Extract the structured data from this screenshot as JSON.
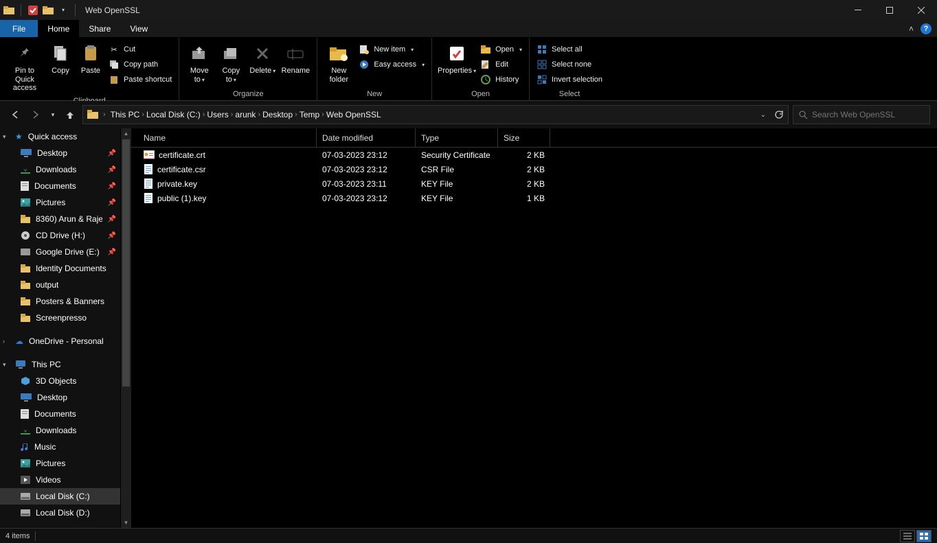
{
  "window": {
    "title": "Web OpenSSL"
  },
  "tabs": {
    "file": "File",
    "home": "Home",
    "share": "Share",
    "view": "View"
  },
  "ribbon": {
    "clipboard": {
      "pin": "Pin to Quick\naccess",
      "copy": "Copy",
      "paste": "Paste",
      "cut": "Cut",
      "copy_path": "Copy path",
      "paste_shortcut": "Paste shortcut",
      "group_label": "Clipboard"
    },
    "organize": {
      "move_to": "Move\nto",
      "copy_to": "Copy\nto",
      "delete": "Delete",
      "rename": "Rename",
      "group_label": "Organize"
    },
    "new": {
      "new_folder": "New\nfolder",
      "new_item": "New item",
      "easy_access": "Easy access",
      "group_label": "New"
    },
    "open": {
      "properties": "Properties",
      "open": "Open",
      "edit": "Edit",
      "history": "History",
      "group_label": "Open"
    },
    "select": {
      "select_all": "Select all",
      "select_none": "Select none",
      "invert": "Invert selection",
      "group_label": "Select"
    }
  },
  "breadcrumb": [
    "This PC",
    "Local Disk (C:)",
    "Users",
    "arunk",
    "Desktop",
    "Temp",
    "Web OpenSSL"
  ],
  "search": {
    "placeholder": "Search Web OpenSSL"
  },
  "sidebar": {
    "quick_access": "Quick access",
    "pinned": [
      {
        "icon": "desktop",
        "label": "Desktop",
        "pin": true
      },
      {
        "icon": "downloads",
        "label": "Downloads",
        "pin": true
      },
      {
        "icon": "documents",
        "label": "Documents",
        "pin": true
      },
      {
        "icon": "pictures",
        "label": "Pictures",
        "pin": true
      },
      {
        "icon": "folder",
        "label": "8360) Arun & Raje",
        "pin": true
      },
      {
        "icon": "disc",
        "label": "CD Drive (H:)",
        "pin": true
      },
      {
        "icon": "drive",
        "label": "Google Drive (E:)",
        "pin": true
      },
      {
        "icon": "folder",
        "label": "Identity Documents",
        "pin": false
      },
      {
        "icon": "folder",
        "label": "output",
        "pin": false
      },
      {
        "icon": "folder",
        "label": "Posters & Banners",
        "pin": false
      },
      {
        "icon": "folder",
        "label": "Screenpresso",
        "pin": false
      }
    ],
    "onedrive": "OneDrive - Personal",
    "this_pc": "This PC",
    "pc_items": [
      {
        "icon": "3d",
        "label": "3D Objects"
      },
      {
        "icon": "desktop",
        "label": "Desktop"
      },
      {
        "icon": "documents",
        "label": "Documents"
      },
      {
        "icon": "downloads",
        "label": "Downloads"
      },
      {
        "icon": "music",
        "label": "Music"
      },
      {
        "icon": "pictures",
        "label": "Pictures"
      },
      {
        "icon": "videos",
        "label": "Videos"
      },
      {
        "icon": "disk",
        "label": "Local Disk (C:)",
        "selected": true
      },
      {
        "icon": "disk",
        "label": "Local Disk (D:)"
      }
    ]
  },
  "columns": {
    "name": "Name",
    "date": "Date modified",
    "type": "Type",
    "size": "Size"
  },
  "files": [
    {
      "icon": "cert",
      "name": "certificate.crt",
      "date": "07-03-2023 23:12",
      "type": "Security Certificate",
      "size": "2 KB"
    },
    {
      "icon": "file",
      "name": "certificate.csr",
      "date": "07-03-2023 23:12",
      "type": "CSR File",
      "size": "2 KB"
    },
    {
      "icon": "file",
      "name": "private.key",
      "date": "07-03-2023 23:11",
      "type": "KEY File",
      "size": "2 KB"
    },
    {
      "icon": "file",
      "name": "public (1).key",
      "date": "07-03-2023 23:12",
      "type": "KEY File",
      "size": "1 KB"
    }
  ],
  "status": {
    "text": "4 items"
  }
}
